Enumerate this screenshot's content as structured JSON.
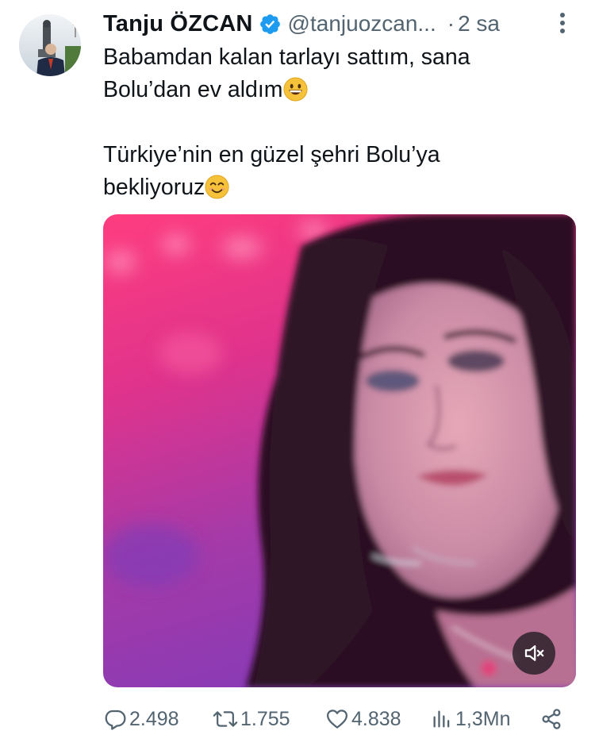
{
  "author": {
    "display_name": "Tanju ÖZCAN",
    "handle": "@tanjuozcan...",
    "separator": "·",
    "time": "2 sa",
    "verified": true
  },
  "tweet": {
    "line1": "Babamdan kalan tarlayı sattım, sana",
    "line2": "Bolu’dan ev aldım",
    "line3": "Türkiye’nin en güzel şehri Bolu’ya",
    "line4": "bekliyoruz",
    "emoji_1": "grinning-face-emoji",
    "emoji_2": "smiling-face-with-smiling-eyes-emoji"
  },
  "media": {
    "type": "video",
    "mute_icon": "speaker-muted-icon"
  },
  "stats": {
    "replies": "2.498",
    "retweets": "1.755",
    "likes": "4.838",
    "views": "1,3Mn"
  },
  "icons": {
    "reply": "speech-bubble-icon",
    "retweet": "retweet-icon",
    "like": "heart-icon",
    "views": "bar-chart-icon",
    "share": "share-icon",
    "more": "more-vertical-icon"
  },
  "colors": {
    "text": "#0f1419",
    "secondary": "#536471",
    "verified": "#1d9bf0"
  }
}
